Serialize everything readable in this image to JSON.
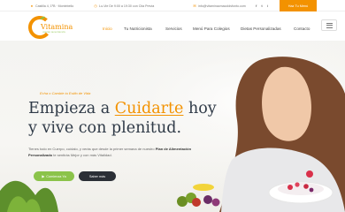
{
  "topbar": {
    "address": "Castilla 4, 1ºB · Montebello",
    "hours": "Lu-Vie De 9:00 a 19:30 con Cita Previa",
    "email": "info@vitaminacmacoldsfonto.com",
    "social": [
      "f",
      "t",
      "i"
    ],
    "cta_label": "Haz Tu Menú"
  },
  "brand": {
    "name": "Vitamina",
    "tagline": "CENTRO DE NUTRICIÓN",
    "accent": "#f39200",
    "green": "#8bc34a"
  },
  "nav": {
    "items": [
      {
        "label": "Inicio",
        "active": true
      },
      {
        "label": "Tu Nutricionista"
      },
      {
        "label": "Servicios"
      },
      {
        "label": "Menú Para Colegios"
      },
      {
        "label": "Dietas Personalizadas"
      },
      {
        "label": "Contacto"
      }
    ]
  },
  "hero": {
    "eyebrow": "Echa o Cambie tu Estilo de Vida",
    "title_part1": "Empieza a",
    "title_accent": "Cuidarte",
    "title_part2": "hoy",
    "title_line2": "y vive con plenitud.",
    "paragraph_intro": "Tienes todo en Cuerpo, cuídalo, y verás que desde la primer semana de nuestro",
    "paragraph_bold": "Plan de Alimentación Personalizado",
    "paragraph_end": "te sentirás Mejor y con más Vitalidad.",
    "primary_cta": "Comienza Ya",
    "secondary_cta": "Saber más"
  }
}
